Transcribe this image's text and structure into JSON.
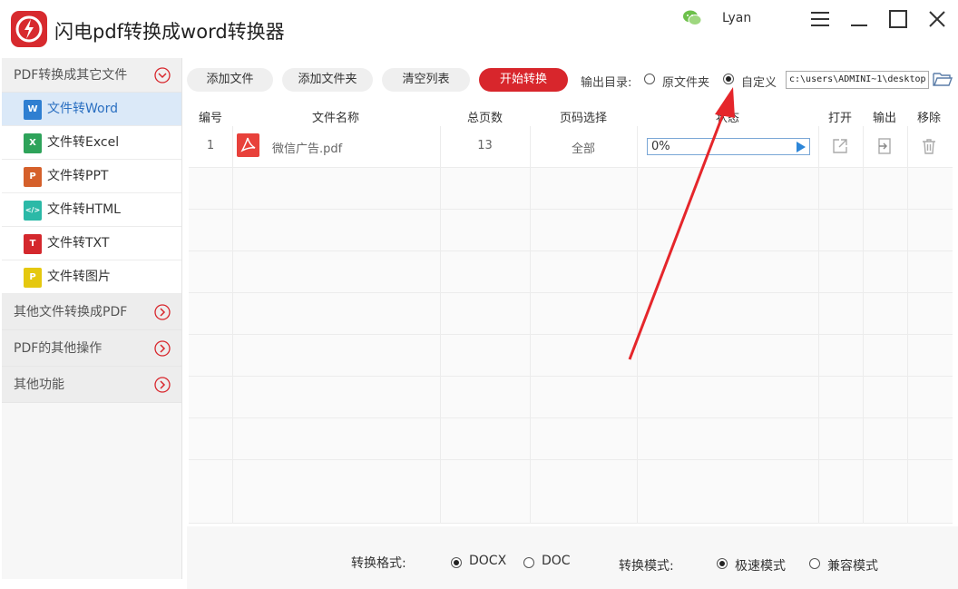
{
  "window": {
    "title": "闪电pdf转换成word转换器",
    "username": "Lyan"
  },
  "sidebar": {
    "groups": [
      {
        "label": "PDF转换成其它文件",
        "expanded": true
      },
      {
        "label": "其他文件转换成PDF",
        "expanded": false
      },
      {
        "label": "PDF的其他操作",
        "expanded": false
      },
      {
        "label": "其他功能",
        "expanded": false
      }
    ],
    "items": [
      {
        "label": "文件转Word",
        "icon": "W",
        "color": "#2f7fd1",
        "active": true
      },
      {
        "label": "文件转Excel",
        "icon": "X",
        "color": "#2ea35a",
        "active": false
      },
      {
        "label": "文件转PPT",
        "icon": "P",
        "color": "#d5602b",
        "active": false
      },
      {
        "label": "文件转HTML",
        "icon": "</>",
        "color": "#2bb9a7",
        "active": false
      },
      {
        "label": "文件转TXT",
        "icon": "T",
        "color": "#d4282d",
        "active": false
      },
      {
        "label": "文件转图片",
        "icon": "P",
        "color": "#e5c80f",
        "active": false
      }
    ]
  },
  "toolbar": {
    "add_file": "添加文件",
    "add_folder": "添加文件夹",
    "clear_list": "清空列表",
    "start": "开始转换",
    "output_label": "输出目录:",
    "option_original": "原文件夹",
    "option_custom": "自定义",
    "path": "c:\\users\\ADMINI~1\\desktop"
  },
  "table": {
    "headers": [
      "编号",
      "文件名称",
      "总页数",
      "页码选择",
      "状态",
      "打开",
      "输出",
      "移除"
    ],
    "rows": [
      {
        "index": "1",
        "name": "微信广告.pdf",
        "pages": "13",
        "range": "全部",
        "progress": "0%",
        "progress_value": 0
      }
    ]
  },
  "bottom": {
    "format_label": "转换格式:",
    "format_docx": "DOCX",
    "format_doc": "DOC",
    "mode_label": "转换模式:",
    "mode_fast": "极速模式",
    "mode_compat": "兼容模式"
  },
  "colors": {
    "accent": "#d8262c",
    "active_item_bg": "#dbe9f8",
    "progress": "#7aa7d6"
  }
}
